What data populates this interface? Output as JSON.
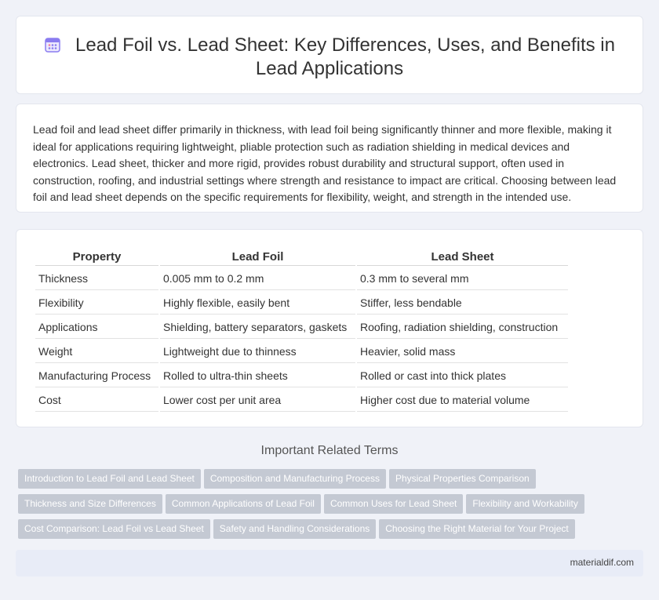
{
  "header": {
    "title": "Lead Foil vs. Lead Sheet: Key Differences, Uses, and Benefits in Lead Applications",
    "icon": "calendar-icon",
    "icon_color": "#8a7cf0"
  },
  "summary": {
    "text": "Lead foil and lead sheet differ primarily in thickness, with lead foil being significantly thinner and more flexible, making it ideal for applications requiring lightweight, pliable protection such as radiation shielding in medical devices and electronics. Lead sheet, thicker and more rigid, provides robust durability and structural support, often used in construction, roofing, and industrial settings where strength and resistance to impact are critical. Choosing between lead foil and lead sheet depends on the specific requirements for flexibility, weight, and strength in the intended use."
  },
  "table": {
    "headers": [
      "Property",
      "Lead Foil",
      "Lead Sheet"
    ],
    "rows": [
      [
        "Thickness",
        "0.005 mm to 0.2 mm",
        "0.3 mm to several mm"
      ],
      [
        "Flexibility",
        "Highly flexible, easily bent",
        "Stiffer, less bendable"
      ],
      [
        "Applications",
        "Shielding, battery separators, gaskets",
        "Roofing, radiation shielding, construction"
      ],
      [
        "Weight",
        "Lightweight due to thinness",
        "Heavier, solid mass"
      ],
      [
        "Manufacturing Process",
        "Rolled to ultra-thin sheets",
        "Rolled or cast into thick plates"
      ],
      [
        "Cost",
        "Lower cost per unit area",
        "Higher cost due to material volume"
      ]
    ]
  },
  "related": {
    "title": "Important Related Terms",
    "tag_rows": [
      [
        "Introduction to Lead Foil and Lead Sheet",
        "Composition and Manufacturing Process",
        "Physical Properties Comparison"
      ],
      [
        "Thickness and Size Differences",
        "Common Applications of Lead Foil",
        "Common Uses for Lead Sheet",
        "Flexibility and Workability"
      ],
      [
        "Cost Comparison: Lead Foil vs Lead Sheet",
        "Safety and Handling Considerations",
        "Choosing the Right Material for Your Project"
      ]
    ]
  },
  "footer": {
    "site": "materialdif.com"
  }
}
